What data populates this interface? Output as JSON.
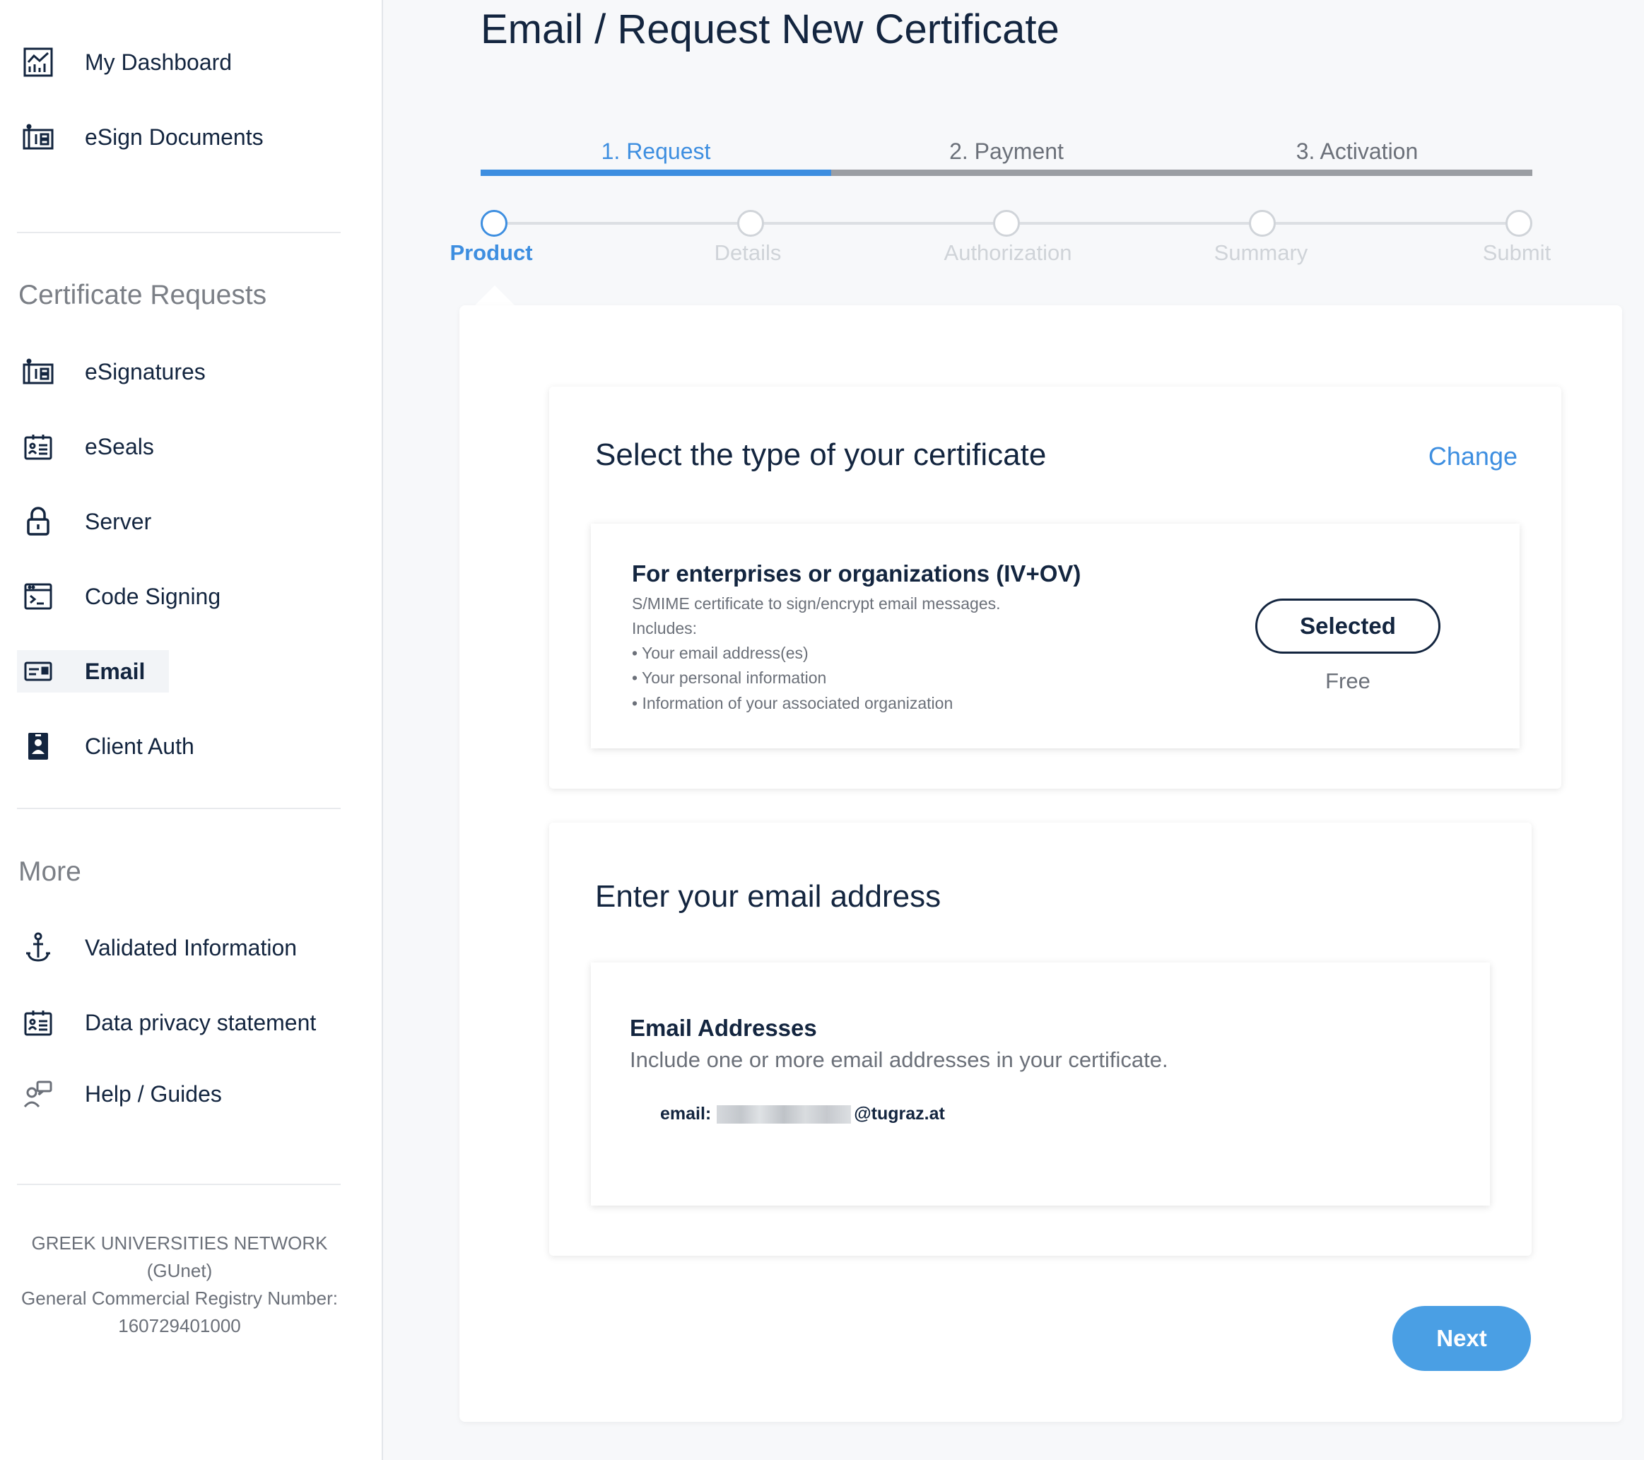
{
  "sidebar": {
    "top_items": [
      {
        "label": "My Dashboard",
        "icon": "dashboard-icon"
      },
      {
        "label": "eSign Documents",
        "icon": "esign-icon"
      }
    ],
    "cert_section_title": "Certificate Requests",
    "cert_items": [
      {
        "label": "eSignatures",
        "icon": "esign-icon"
      },
      {
        "label": "eSeals",
        "icon": "seal-card-icon"
      },
      {
        "label": "Server",
        "icon": "lock-icon"
      },
      {
        "label": "Code Signing",
        "icon": "terminal-icon"
      },
      {
        "label": "Email",
        "icon": "email-card-icon",
        "active": true
      },
      {
        "label": "Client Auth",
        "icon": "badge-icon"
      }
    ],
    "more_section_title": "More",
    "more_items": [
      {
        "label": "Validated Information",
        "icon": "person-anchor-icon"
      },
      {
        "label": "Data privacy statement",
        "icon": "seal-card-icon"
      },
      {
        "label": "Help / Guides",
        "icon": "help-person-icon"
      }
    ],
    "footer": {
      "line1": "GREEK UNIVERSITIES NETWORK",
      "line2": "(GUnet)",
      "line3": "General Commercial Registry Number:",
      "line4": "160729401000"
    }
  },
  "page": {
    "title": "Email / Request New Certificate"
  },
  "phases": {
    "tabs": [
      "1. Request",
      "2. Payment",
      "3. Activation"
    ],
    "active_index": 0,
    "progress_fraction": 0.333
  },
  "steps": {
    "labels": [
      "Product",
      "Details",
      "Authorization",
      "Summary",
      "Submit"
    ],
    "active_index": 0
  },
  "certificate_type": {
    "title": "Select the type of your certificate",
    "change_label": "Change",
    "product": {
      "title": "For enterprises or organizations (IV+OV)",
      "description": "S/MIME certificate to sign/encrypt email messages.",
      "includes_label": "Includes:",
      "includes": [
        "• Your email address(es)",
        "• Your personal information",
        "• Information of your associated organization"
      ],
      "selected_label": "Selected",
      "price": "Free"
    }
  },
  "email_section": {
    "title": "Enter your email address",
    "card_title": "Email Addresses",
    "card_desc": "Include one or more email addresses in your certificate.",
    "email_label": "email:",
    "email_domain": "@tugraz.at"
  },
  "actions": {
    "next_label": "Next"
  },
  "colors": {
    "accent": "#3d8ee0",
    "primary_text": "#13253f",
    "muted_text": "#6b7079",
    "button_blue": "#4a9fe4"
  }
}
